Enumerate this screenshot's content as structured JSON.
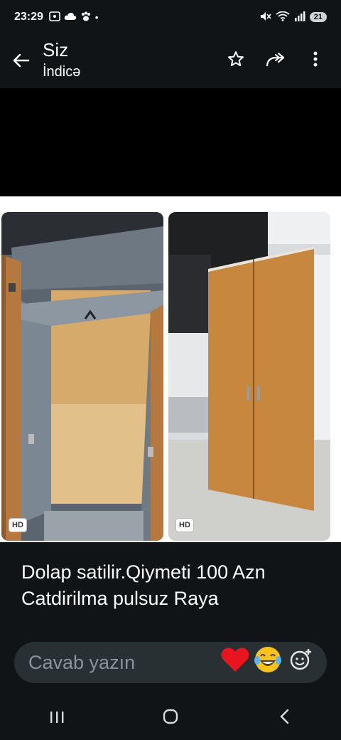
{
  "status": {
    "time": "23:29",
    "battery": "21"
  },
  "header": {
    "title": "Siz",
    "subtitle": "İndicə"
  },
  "photos": [
    {
      "badge": "HD"
    },
    {
      "badge": "HD"
    }
  ],
  "caption": {
    "line1": "Dolap satilir.Qiymeti 100 Azn",
    "line2": "Catdirilma pulsuz Raya"
  },
  "reply": {
    "placeholder": "Cavab yazın"
  },
  "icons": {
    "back": "arrow-left-icon",
    "star": "star-icon",
    "forward": "forward-icon",
    "menu": "more-vert-icon",
    "heart": "heart-icon",
    "laugh": "laugh-cry-emoji-icon",
    "emoji_add": "emoji-add-icon"
  },
  "colors": {
    "background": "#101416",
    "reply_bg": "#283033",
    "heart": "#e8141e"
  }
}
